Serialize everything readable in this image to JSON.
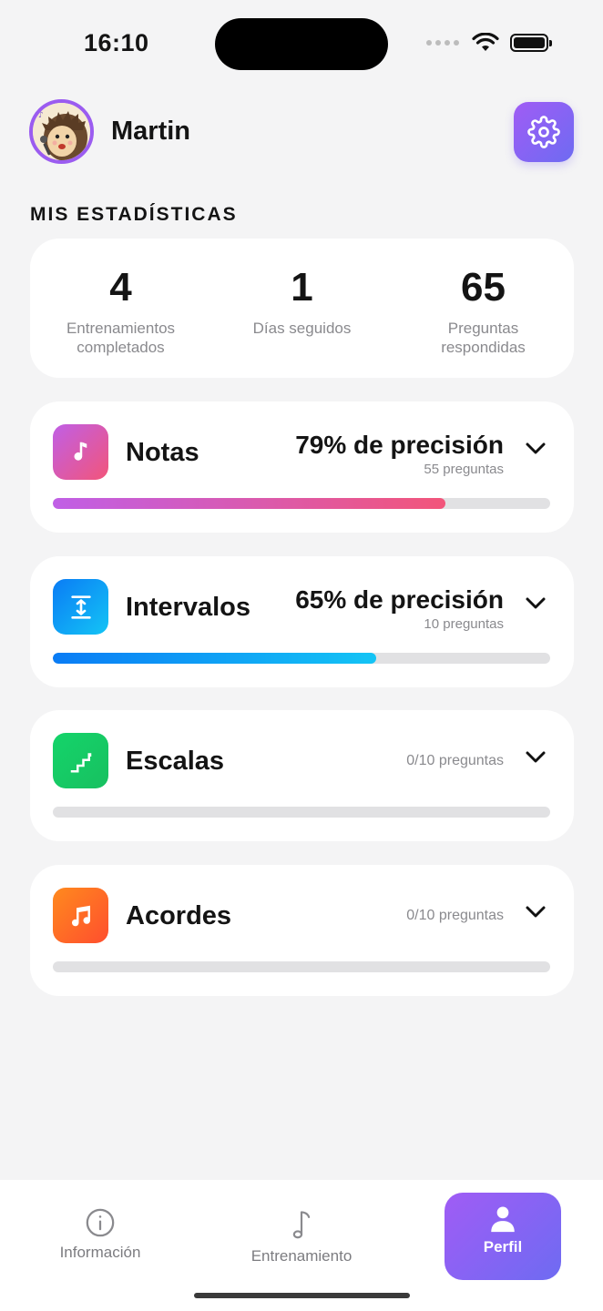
{
  "status_bar": {
    "time": "16:10"
  },
  "header": {
    "user_name": "Martin",
    "avatar_icon": "hedgehog-singer-avatar",
    "settings_icon": "gear-icon"
  },
  "section_title": "MIS ESTADÍSTICAS",
  "summary": [
    {
      "value": "4",
      "label": "Entrenamientos completados"
    },
    {
      "value": "1",
      "label": "Días seguidos"
    },
    {
      "value": "65",
      "label": "Preguntas respondidas"
    }
  ],
  "categories": [
    {
      "name": "Notas",
      "precision": "79% de precisión",
      "count": "55 preguntas",
      "progress": 0.79,
      "icon": "music-note-icon",
      "colors": [
        "#c05fe6",
        "#f2557a"
      ]
    },
    {
      "name": "Intervalos",
      "precision": "65% de precisión",
      "count": "10 preguntas",
      "progress": 0.65,
      "icon": "interval-arrows-icon",
      "colors": [
        "#0a7cf5",
        "#14c4f5"
      ]
    },
    {
      "name": "Escalas",
      "precision": "",
      "count": "0/10 preguntas",
      "progress": 0,
      "icon": "stairs-icon",
      "colors": [
        "#14d46a",
        "#18c060"
      ]
    },
    {
      "name": "Acordes",
      "precision": "",
      "count": "0/10 preguntas",
      "progress": 0,
      "icon": "music-notes-icon",
      "colors": [
        "#ff8a1e",
        "#ff4e2e"
      ]
    }
  ],
  "tab_bar": {
    "tabs": [
      {
        "label": "Información",
        "icon": "info-icon",
        "active": false
      },
      {
        "label": "Entrenamiento",
        "icon": "music-note-icon",
        "active": false
      },
      {
        "label": "Perfil",
        "icon": "person-icon",
        "active": true
      }
    ]
  },
  "colors": {
    "accent_start": "#a05cf5",
    "accent_end": "#6e6bf2",
    "background": "#f4f4f5"
  }
}
